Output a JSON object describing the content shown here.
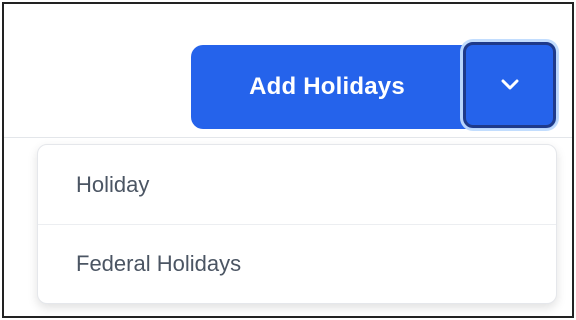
{
  "split_button": {
    "primary_label": "Add Holidays",
    "toggle_icon": "chevron-down-icon",
    "color": "#2563eb",
    "focus_ring_color": "#bfdbfe"
  },
  "dropdown": {
    "items": [
      {
        "label": "Holiday"
      },
      {
        "label": "Federal Holidays"
      }
    ]
  }
}
